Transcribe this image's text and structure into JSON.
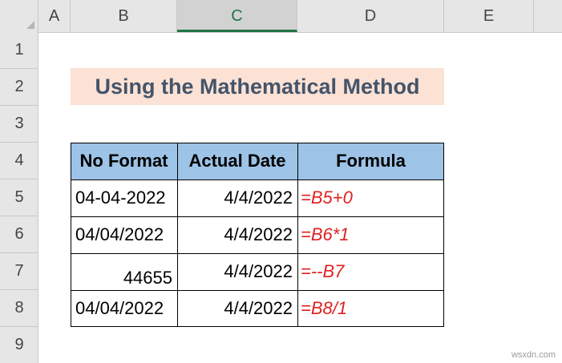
{
  "columns": [
    "A",
    "B",
    "C",
    "D",
    "E"
  ],
  "selected_column": "C",
  "rows": [
    "1",
    "2",
    "3",
    "4",
    "5",
    "6",
    "7",
    "8",
    "9"
  ],
  "title": "Using the Mathematical Method",
  "table": {
    "headers": [
      "No Format",
      "Actual Date",
      "Formula"
    ],
    "rows": [
      [
        "04-04-2022",
        "4/4/2022",
        "=B5+0"
      ],
      [
        "04/04/2022",
        "4/4/2022",
        "=B6*1"
      ],
      [
        "44655",
        "4/4/2022",
        "=--B7"
      ],
      [
        "04/04/2022",
        "4/4/2022",
        "=B8/1"
      ]
    ]
  },
  "colors": {
    "title_fill": "#fbe2d5",
    "title_text": "#44546a",
    "header_fill": "#9dc3e6",
    "formula_text": "#e02020",
    "selected_header_accent": "#217346"
  },
  "watermark": "wsxdn.com"
}
